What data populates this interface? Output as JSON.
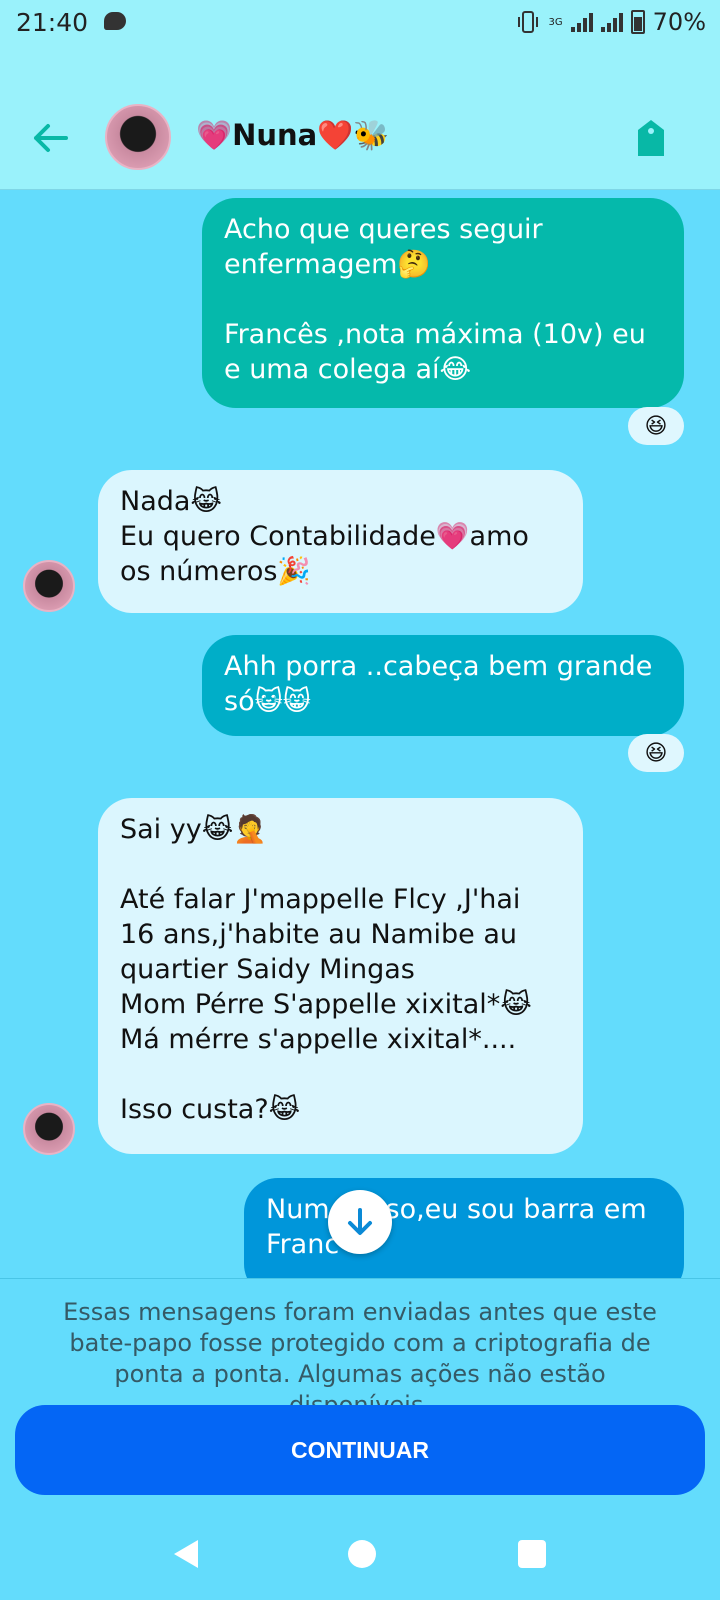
{
  "status_bar": {
    "time": "21:40",
    "network": "3G",
    "battery": "70%"
  },
  "header": {
    "contact_name": "💗Nuna❤️🐝"
  },
  "messages": [
    {
      "type": "outgoing",
      "text": "Acho que queres seguir enfermagem🤔\n\nFrancês ,nota máxima (10v) eu e uma colega aí😂",
      "reaction": "😆"
    },
    {
      "type": "incoming",
      "text": "Nada😹\nEu quero Contabilidade💗amo os números🎉"
    },
    {
      "type": "outgoing",
      "text": "Ahh porra ..cabeça bem grande só😺😸",
      "reaction": "😆"
    },
    {
      "type": "incoming",
      "text": "Sai yy😹🤦\n\nAté falar J'mappelle Flcy ,J'hai 16 ans,j'habite au Namibe au quartier Saidy Mingas\nMom Pérre S'appelle xixital*😹\nMá mérre s'appelle xixital*....\n\nIsso custa?😹"
    },
    {
      "type": "outgoing",
      "text": "Num    isso,eu sou barra em\nFranc"
    }
  ],
  "footer": {
    "notice": "Essas mensagens foram enviadas antes que este bate-papo fosse protegido com a criptografia de ponta a ponta. Algumas ações não estão disponíveis.",
    "continue_label": "CONTINUAR"
  },
  "colors": {
    "chat_background": "#63dcfc",
    "header_background": "#9af2fb",
    "outgoing_bubble": "#05b9ab",
    "incoming_bubble": "#dbf6fe",
    "accent": "#0466f5"
  },
  "icons": {
    "back": "arrow-left-icon",
    "tag": "tag-icon",
    "scroll_down": "arrow-down-icon"
  }
}
